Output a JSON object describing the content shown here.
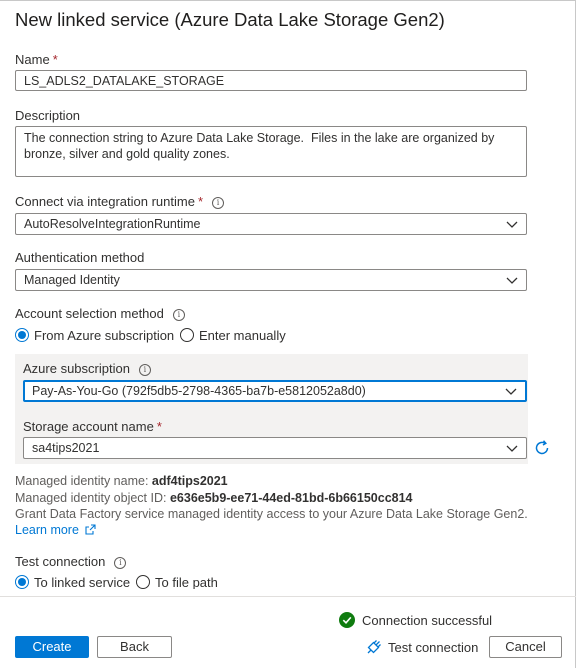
{
  "title": "New linked service (Azure Data Lake Storage Gen2)",
  "name": {
    "label": "Name",
    "required": "*",
    "value": "LS_ADLS2_DATALAKE_STORAGE"
  },
  "description": {
    "label": "Description",
    "value": "The connection string to Azure Data Lake Storage.  Files in the lake are organized by bronze, silver and gold quality zones."
  },
  "runtime": {
    "label": "Connect via integration runtime",
    "required": "*",
    "value": "AutoResolveIntegrationRuntime"
  },
  "auth": {
    "label": "Authentication method",
    "value": "Managed Identity"
  },
  "account_selection": {
    "label": "Account selection method",
    "options": [
      "From Azure subscription",
      "Enter manually"
    ],
    "selected": "From Azure subscription"
  },
  "subscription": {
    "label": "Azure subscription",
    "value": "Pay-As-You-Go (792f5db5-2798-4365-ba7b-e5812052a8d0)"
  },
  "storage": {
    "label": "Storage account name",
    "required": "*",
    "value": "sa4tips2021"
  },
  "identity": {
    "name_label": "Managed identity name:",
    "name_value": "adf4tips2021",
    "object_label": "Managed identity object ID:",
    "object_value": "e636e5b9-ee71-44ed-81bd-6b66150cc814",
    "grant_text": "Grant Data Factory service managed identity access to your Azure Data Lake Storage Gen2.",
    "learn_more": "Learn more"
  },
  "test_connection": {
    "label": "Test connection",
    "options": [
      "To linked service",
      "To file path"
    ],
    "selected": "To linked service"
  },
  "status": {
    "text": "Connection successful",
    "color": "#107c10"
  },
  "footer": {
    "create": "Create",
    "back": "Back",
    "test": "Test connection",
    "cancel": "Cancel"
  },
  "colors": {
    "accent": "#0078d4",
    "panel": "#f3f2f1"
  }
}
